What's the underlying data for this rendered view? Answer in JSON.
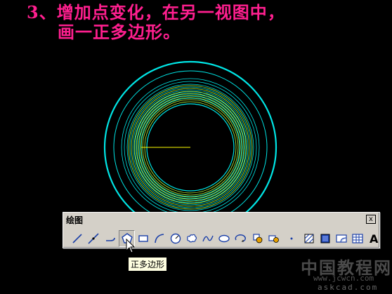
{
  "caption": {
    "line1": "3、增加点变化，在另一视图中，",
    "line2": "画一正多边形。"
  },
  "toolbar": {
    "title": "绘图",
    "close_label": "x",
    "buttons": [
      {
        "name": "line-icon"
      },
      {
        "name": "construction-line-icon"
      },
      {
        "name": "polyline-icon"
      },
      {
        "name": "polygon-icon",
        "pressed": true
      },
      {
        "name": "rectangle-icon"
      },
      {
        "name": "arc-icon"
      },
      {
        "name": "circle-icon"
      },
      {
        "name": "revision-cloud-icon"
      },
      {
        "name": "spline-icon"
      },
      {
        "name": "ellipse-icon"
      },
      {
        "name": "ellipse-arc-icon"
      },
      {
        "name": "insert-block-icon"
      },
      {
        "name": "make-block-icon"
      },
      {
        "name": "point-icon"
      },
      {
        "name": "hatch-icon"
      },
      {
        "name": "gradient-icon"
      },
      {
        "name": "region-icon"
      },
      {
        "name": "table-icon"
      },
      {
        "name": "multiline-text-icon"
      }
    ]
  },
  "tooltip": {
    "text": "正多边形"
  },
  "watermark": {
    "title": "中国教程网",
    "url1": "www.jcwcn.com",
    "url2": "askcad.com"
  },
  "colors": {
    "background": "#000000",
    "circle": "#00e5e5",
    "inner_circle": "#b8ff3a",
    "line": "#ffff00",
    "caption": "#ff1f8f"
  }
}
